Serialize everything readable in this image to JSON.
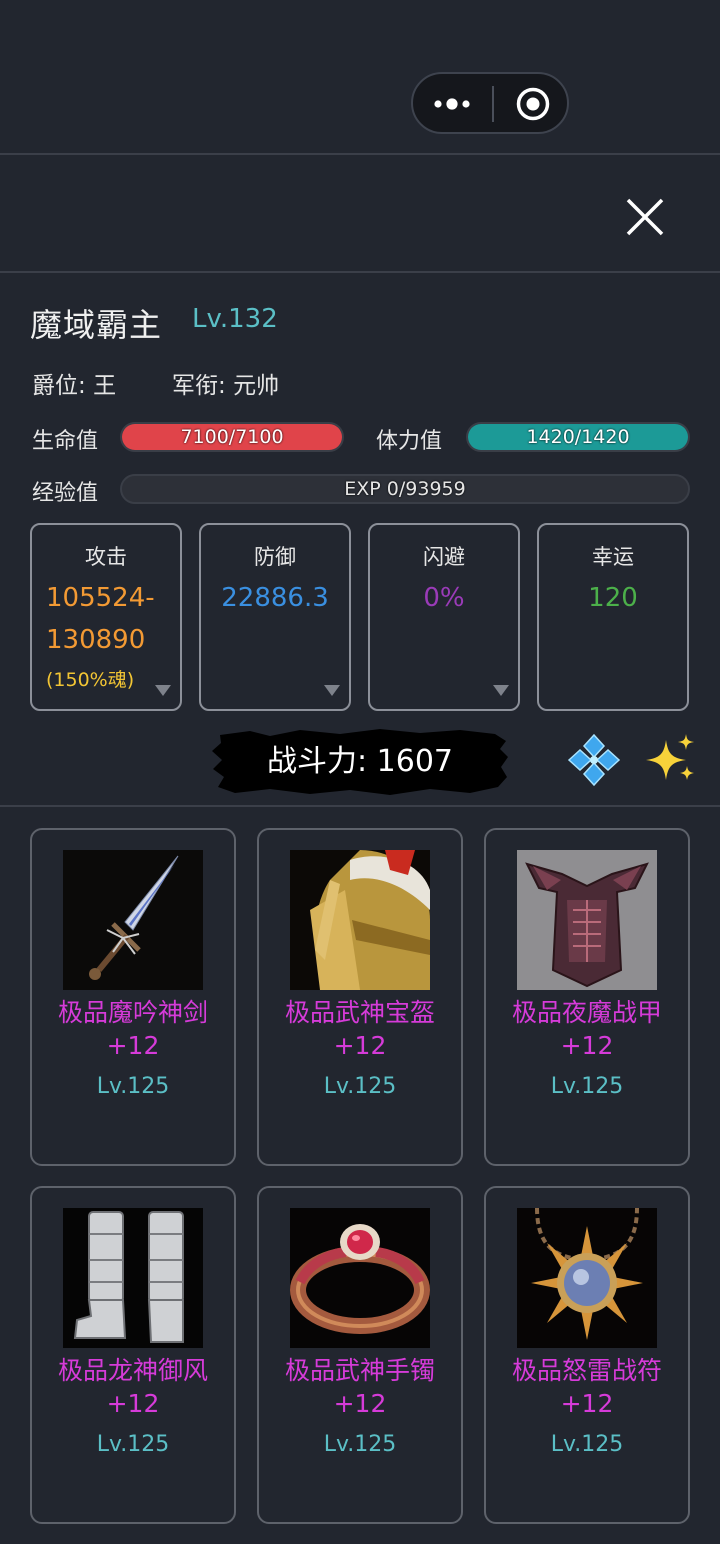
{
  "header": {
    "close_label": "close"
  },
  "character": {
    "name": "魔域霸主",
    "level": "Lv.132",
    "rank_label": "爵位:",
    "rank_value": "王",
    "title_label": "军衔:",
    "title_value": "元帅"
  },
  "bars": {
    "hp": {
      "label": "生命值",
      "text": "7100/7100",
      "fraction": 1.0,
      "color": "#e0444a"
    },
    "stamina": {
      "label": "体力值",
      "text": "1420/1420",
      "fraction": 1.0,
      "color": "#1c9a97"
    },
    "exp": {
      "label": "经验值",
      "text": "EXP 0/93959",
      "fraction": 0.0
    }
  },
  "stats": [
    {
      "title": "攻击",
      "value": "105524-130890",
      "note": "(150%魂)",
      "color": "#f39a34",
      "expandable": true
    },
    {
      "title": "防御",
      "value": "22886.3",
      "color": "#3a8fe0",
      "expandable": true
    },
    {
      "title": "闪避",
      "value": "0%",
      "color": "#9a3bb8",
      "expandable": true
    },
    {
      "title": "幸运",
      "value": "120",
      "color": "#4cb04a",
      "expandable": false
    }
  ],
  "power": {
    "label": "战斗力:",
    "value": "1607"
  },
  "equipment": [
    {
      "name": "极品魔吟神剑",
      "plus": "+12",
      "level": "Lv.125",
      "icon": "sword-icon"
    },
    {
      "name": "极品武神宝盔",
      "plus": "+12",
      "level": "Lv.125",
      "icon": "helmet-icon"
    },
    {
      "name": "极品夜魔战甲",
      "plus": "+12",
      "level": "Lv.125",
      "icon": "armor-icon"
    },
    {
      "name": "极品龙神御风",
      "plus": "+12",
      "level": "Lv.125",
      "icon": "boots-icon"
    },
    {
      "name": "极品武神手镯",
      "plus": "+12",
      "level": "Lv.125",
      "icon": "bracelet-icon"
    },
    {
      "name": "极品怒雷战符",
      "plus": "+12",
      "level": "Lv.125",
      "icon": "amulet-icon"
    }
  ]
}
